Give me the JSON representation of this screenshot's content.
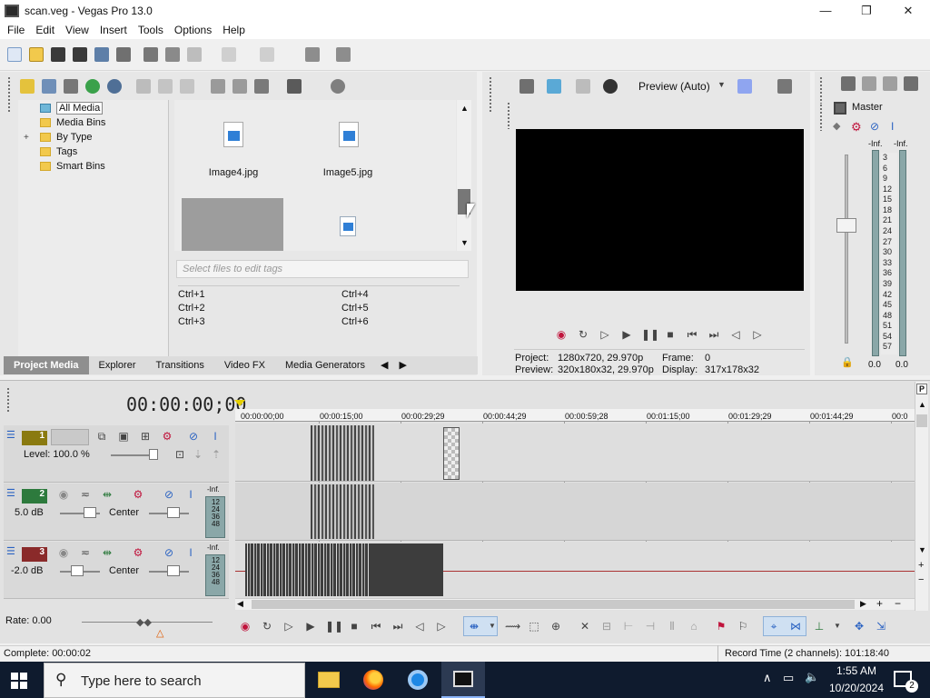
{
  "window": {
    "title": "scan.veg - Vegas Pro 13.0",
    "min_symbol": "—",
    "max_symbol": "❐",
    "close_symbol": "✕"
  },
  "menu": [
    "File",
    "Edit",
    "View",
    "Insert",
    "Tools",
    "Options",
    "Help"
  ],
  "media_tree": {
    "items": [
      {
        "label": "All Media",
        "selected": true
      },
      {
        "label": "Media Bins",
        "selected": false
      },
      {
        "label": "By Type",
        "selected": false,
        "expander": "+"
      },
      {
        "label": "Tags",
        "selected": false
      },
      {
        "label": "Smart Bins",
        "selected": false
      }
    ]
  },
  "media_files": [
    {
      "name": "Image4.jpg"
    },
    {
      "name": "Image5.jpg"
    }
  ],
  "tags": {
    "placeholder": "Select files to edit tags",
    "shortcuts_left": [
      "Ctrl+1",
      "Ctrl+2",
      "Ctrl+3"
    ],
    "shortcuts_right": [
      "Ctrl+4",
      "Ctrl+5",
      "Ctrl+6"
    ]
  },
  "bottom_tabs": [
    "Project Media",
    "Explorer",
    "Transitions",
    "Video FX",
    "Media Generators"
  ],
  "preview": {
    "mode": "Preview (Auto)",
    "project_label": "Project:",
    "project_value": "1280x720, 29.970p",
    "preview_label": "Preview:",
    "preview_value": "320x180x32, 29.970p",
    "frame_label": "Frame:",
    "frame_value": "0",
    "display_label": "Display:",
    "display_value": "317x178x32"
  },
  "master": {
    "label": "Master",
    "inf_left": "-Inf.",
    "inf_right": "-Inf.",
    "scale": [
      "3",
      "6",
      "9",
      "12",
      "15",
      "18",
      "21",
      "24",
      "27",
      "30",
      "33",
      "36",
      "39",
      "42",
      "45",
      "48",
      "51",
      "54",
      "57"
    ],
    "bottom_left": "0.0",
    "bottom_right": "0.0"
  },
  "timeline": {
    "timecode": "00:00:00;00",
    "ruler": [
      "00:00:00;00",
      "00:00:15;00",
      "00:00:29;29",
      "00:00:44;29",
      "00:00:59;28",
      "00:01:15;00",
      "00:01:29;29",
      "00:01:44;29",
      "00:0"
    ],
    "tracks": [
      {
        "number": "1",
        "color": "#8a7a10",
        "kind": "video",
        "level_label": "Level: 100.0 %"
      },
      {
        "number": "2",
        "color": "#2d7a3d",
        "kind": "audio",
        "volume": "5.0 dB",
        "pan": "Center",
        "meter_top": "-Inf."
      },
      {
        "number": "3",
        "color": "#8a2a2a",
        "kind": "audio",
        "volume": "-2.0 dB",
        "pan": "Center",
        "meter_top": "-Inf."
      }
    ],
    "mini_scale": [
      "12",
      "24",
      "36",
      "48"
    ],
    "rate": "Rate: 0.00"
  },
  "status": {
    "left": "Complete: 00:00:02",
    "right": "Record Time (2 channels): 101:18:40"
  },
  "taskbar": {
    "search_placeholder": "Type here to search",
    "time": "1:55 AM",
    "date": "10/20/2024",
    "notif_count": "2"
  },
  "colors": {
    "accent": "#1e88e5",
    "record_red": "#c0143c",
    "taskbar": "#0f1b2e"
  }
}
